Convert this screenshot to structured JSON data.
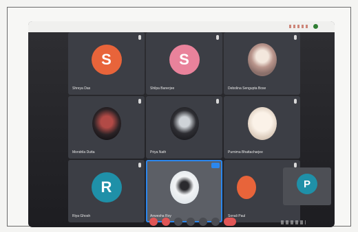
{
  "participants": [
    {
      "initial": "S",
      "name": "Shreya Das",
      "color": "#e8643a"
    },
    {
      "initial": "S",
      "name": "Shilpa Banerjee",
      "color": "#e9829b"
    },
    {
      "initial": "",
      "name": "Debolina Sengupta Bose",
      "color": "#d8c4b6"
    },
    {
      "initial": "",
      "name": "Mondrila Dutta",
      "color": "#7a3a3a"
    },
    {
      "initial": "",
      "name": "Priya Nath",
      "color": "#bfc5cc"
    },
    {
      "initial": "",
      "name": "Purnima Bhattacharjee",
      "color": "#efe3d7"
    },
    {
      "initial": "R",
      "name": "Riya Ghosh",
      "color": "#1f90a8"
    },
    {
      "initial": "",
      "name": "Anwesha Roy",
      "color": "#e6ecef"
    },
    {
      "initial": "",
      "name": "Sonali Paul",
      "color": "#3b3d44"
    }
  ],
  "overlay": {
    "initial": "P",
    "color": "#1f90a8"
  },
  "colors": {
    "accent": "#2b87ee",
    "recording": "#2e7d32",
    "leave": "#e05656"
  }
}
